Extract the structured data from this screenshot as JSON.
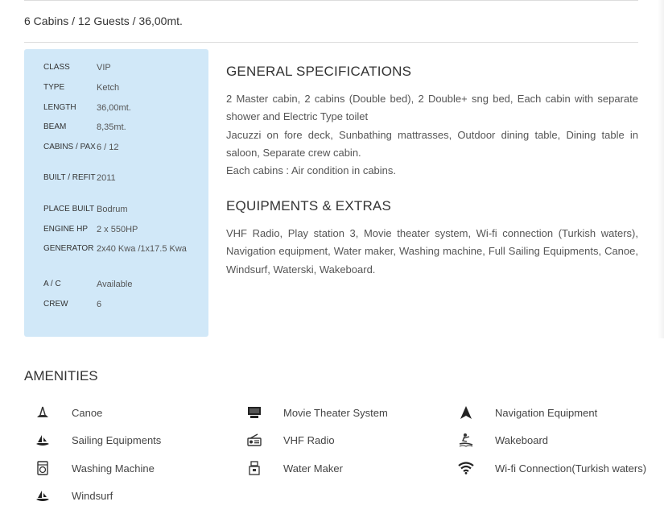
{
  "summary": "6 Cabins / 12 Guests / 36,00mt.",
  "specs": [
    {
      "label": "CLASS",
      "value": "VIP"
    },
    {
      "label": "TYPE",
      "value": "Ketch"
    },
    {
      "label": "LENGTH",
      "value": "36,00mt."
    },
    {
      "label": "BEAM",
      "value": "8,35mt."
    },
    {
      "label": "CABINS / PAX",
      "value": "6 / 12"
    },
    {
      "label": "BUILT / REFIT",
      "value": "2011"
    },
    {
      "label": "PLACE BUILT",
      "value": "Bodrum"
    },
    {
      "label": "ENGINE HP",
      "value": "2 x 550HP"
    },
    {
      "label": "GENERATOR",
      "value": "2x40 Kwa /1x17.5 Kwa"
    },
    {
      "label": "A / C",
      "value": "Available"
    },
    {
      "label": "CREW",
      "value": "6"
    }
  ],
  "general": {
    "title": "GENERAL SPECIFICATIONS",
    "para1": "2 Master cabin, 2 cabins (Double bed), 2 Double+ sng bed, Each cabin with separate shower and Electric Type toilet",
    "para2": "Jacuzzi on fore deck, Sunbathing mattrasses, Outdoor dining table, Dining table in saloon, Separate crew cabin.",
    "para3": "Each cabins : Air condition in cabins."
  },
  "equipments": {
    "title": "EQUIPMENTS & EXTRAS",
    "para": "VHF Radio, Play station 3, Movie theater system, Wi-fi connection (Turkish waters), Navigation equipment, Water maker, Washing machine, Full Sailing Equipments, Canoe, Windsurf, Waterski, Wakeboard."
  },
  "amenities": {
    "title": "AMENITIES",
    "items": [
      {
        "label": "Canoe",
        "icon": "canoe-icon"
      },
      {
        "label": "Movie Theater System",
        "icon": "movie-theater-icon"
      },
      {
        "label": "Navigation Equipment",
        "icon": "navigation-icon"
      },
      {
        "label": "Sailing Equipments",
        "icon": "sailing-icon"
      },
      {
        "label": "VHF Radio",
        "icon": "radio-icon"
      },
      {
        "label": "Wakeboard",
        "icon": "wakeboard-icon"
      },
      {
        "label": "Washing Machine",
        "icon": "washing-machine-icon"
      },
      {
        "label": "Water Maker",
        "icon": "water-maker-icon"
      },
      {
        "label": "Wi-fi Connection(Turkish waters)",
        "icon": "wifi-icon"
      },
      {
        "label": "Windsurf",
        "icon": "windsurf-icon"
      }
    ]
  }
}
